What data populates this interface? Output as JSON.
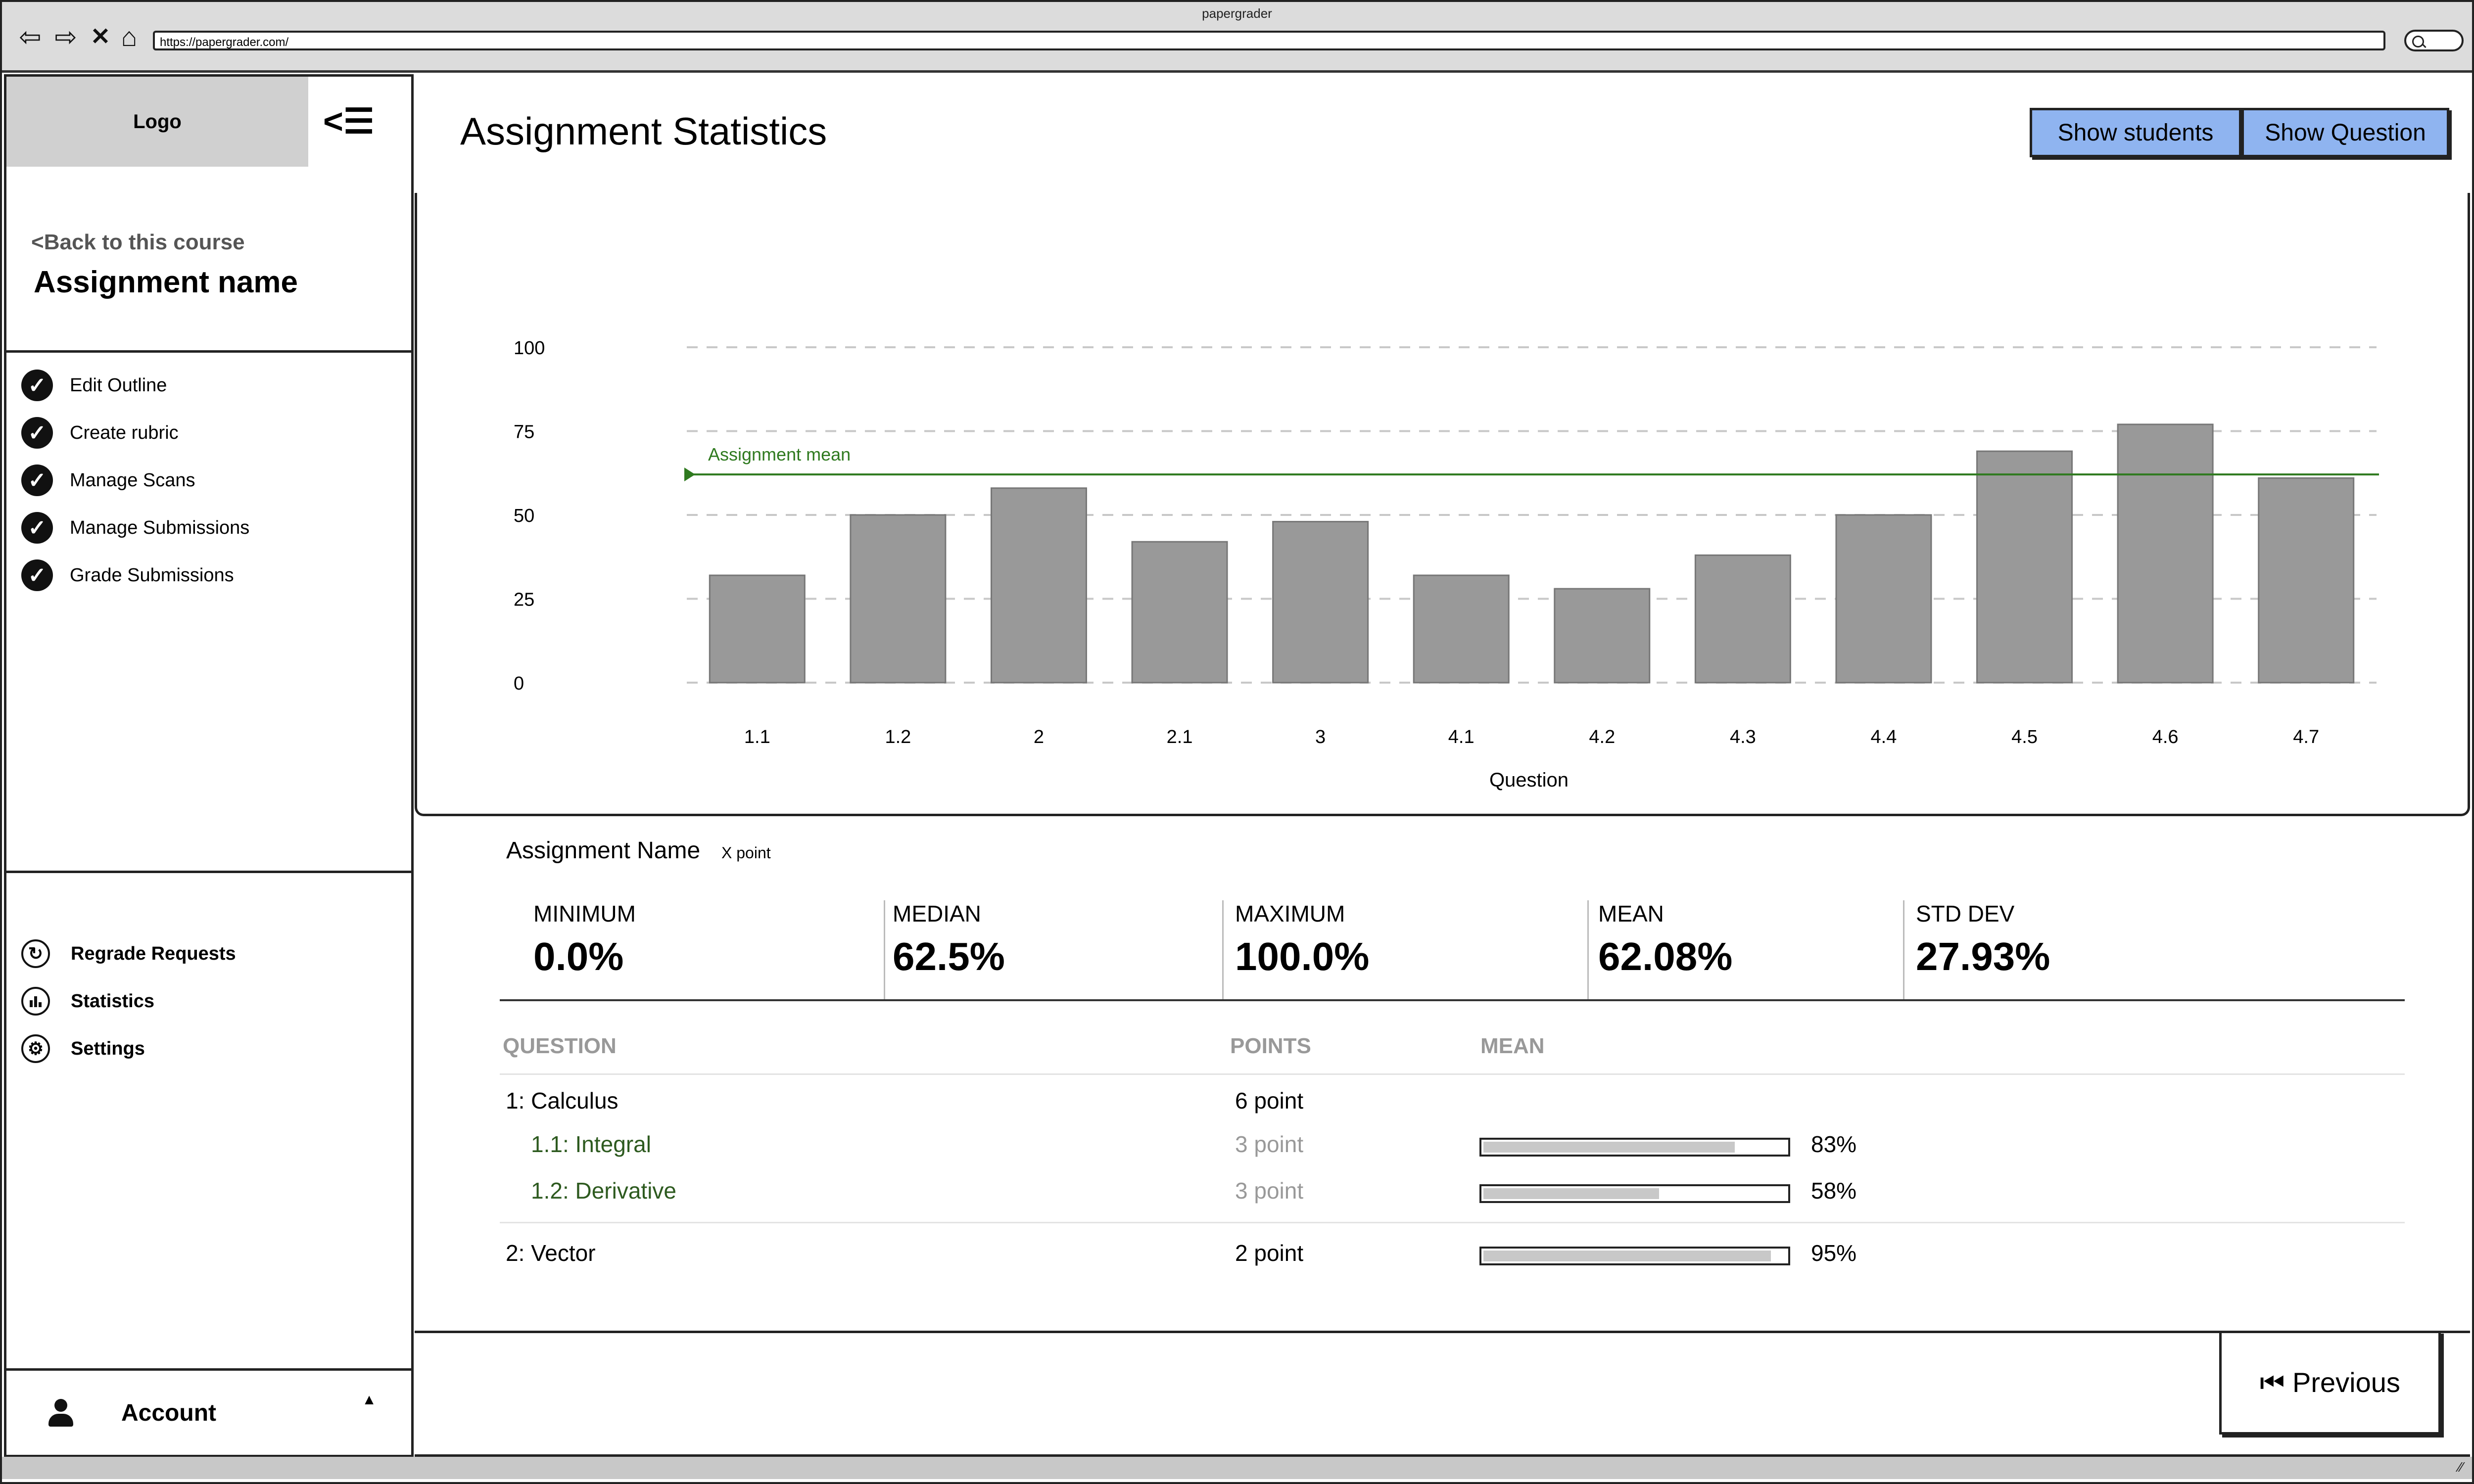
{
  "window": {
    "title": "papergrader",
    "url": "https://papergrader.com/"
  },
  "sidebar": {
    "logo": "Logo",
    "toggle": "<☰",
    "back_link": "<Back to this course",
    "assignment_name": "Assignment name",
    "steps": [
      {
        "label": "Edit Outline"
      },
      {
        "label": "Create rubric"
      },
      {
        "label": "Manage Scans"
      },
      {
        "label": "Manage Submissions"
      },
      {
        "label": "Grade Submissions"
      }
    ],
    "tools": [
      {
        "label": "Regrade Requests",
        "icon": "refresh-icon"
      },
      {
        "label": "Statistics",
        "icon": "bar-chart-icon"
      },
      {
        "label": "Settings",
        "icon": "gear-icon"
      }
    ],
    "account": {
      "label": "Account",
      "caret": "▲"
    }
  },
  "header": {
    "title": "Assignment Statistics",
    "show_students": "Show students",
    "show_question": "Show Question"
  },
  "chart_data": {
    "type": "bar",
    "categories": [
      "1.1",
      "1.2",
      "2",
      "2.1",
      "3",
      "4.1",
      "4.2",
      "4.3",
      "4.4",
      "4.5",
      "4.6",
      "4.7"
    ],
    "values": [
      32,
      50,
      58,
      42,
      48,
      32,
      28,
      38,
      50,
      69,
      77,
      61
    ],
    "mean": 62.08,
    "mean_label": "Assignment mean",
    "xlabel": "Question",
    "ylabel": "",
    "yticks": [
      0,
      25,
      50,
      75,
      100
    ],
    "ylim": [
      0,
      100
    ],
    "grid": "dashed-horizontal",
    "colors": {
      "bar": "#999999",
      "mean": "#2f7a1f",
      "grid": "#c8c8c8"
    }
  },
  "stats": {
    "title": "Assignment Name",
    "subtitle": "X point",
    "items": [
      {
        "label": "MINIMUM",
        "value": "0.0%"
      },
      {
        "label": "MEDIAN",
        "value": "62.5%"
      },
      {
        "label": "MAXIMUM",
        "value": "100.0%"
      },
      {
        "label": "MEAN",
        "value": "62.08%"
      },
      {
        "label": "STD DEV",
        "value": "27.93%"
      }
    ]
  },
  "question_table": {
    "headers": {
      "question": "QUESTION",
      "points": "POINTS",
      "mean": "MEAN"
    },
    "rows": [
      {
        "question": "1: Calculus",
        "points": "6 point",
        "mean": null,
        "pct": ""
      },
      {
        "question": "1.1: Integral",
        "points": "3 point",
        "mean": 0.83,
        "pct": "83%",
        "sub": true
      },
      {
        "question": "1.2: Derivative",
        "points": "3 point",
        "mean": 0.58,
        "pct": "58%",
        "sub": true
      },
      {
        "question": "2: Vector",
        "points": "2 point",
        "mean": 0.95,
        "pct": "95%"
      }
    ]
  },
  "footer": {
    "previous": "⏮ Previous"
  },
  "colors": {
    "button_blue": "#8fb4f0",
    "sub_question": "#2d5a1f",
    "muted": "#999999"
  }
}
